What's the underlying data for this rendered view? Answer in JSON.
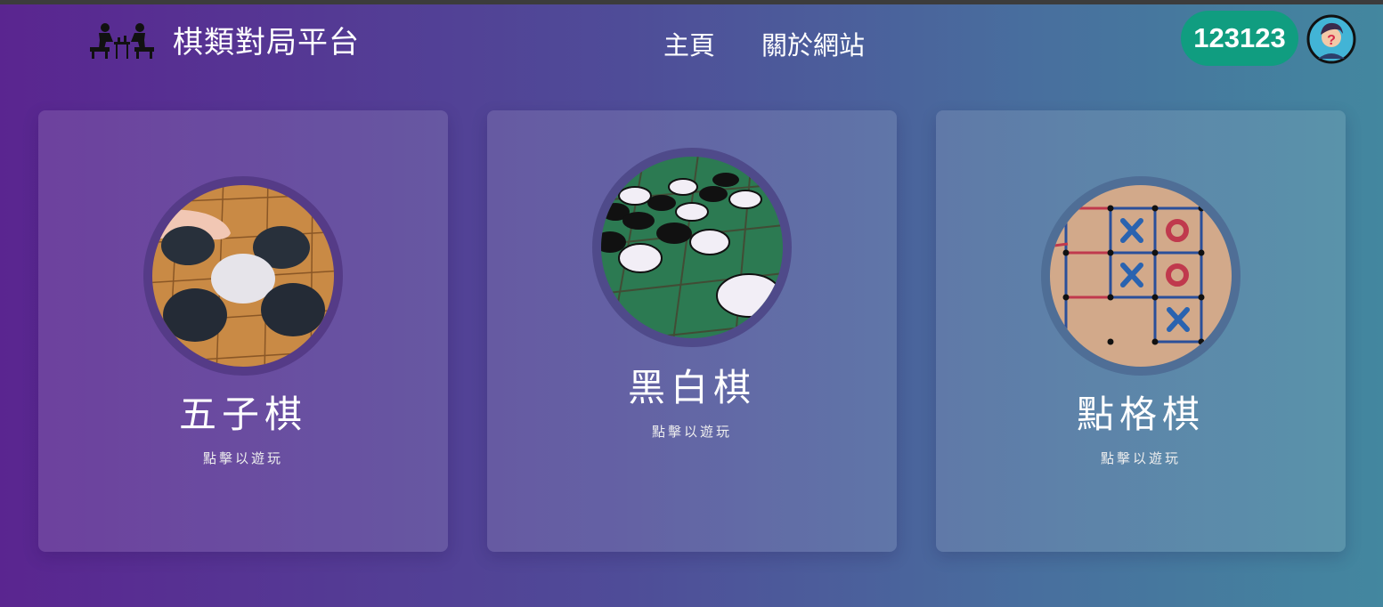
{
  "header": {
    "site_title": "棋類對局平台",
    "logo_icon": "chess-players-icon",
    "nav": [
      {
        "label": "主頁"
      },
      {
        "label": "關於網站"
      }
    ],
    "user_id": "123123",
    "avatar_icon": "unknown-user-avatar-icon"
  },
  "games": [
    {
      "title": "五子棋",
      "subtitle": "點擊以遊玩",
      "image_icon": "gomoku-board-image"
    },
    {
      "title": "黑白棋",
      "subtitle": "點擊以遊玩",
      "image_icon": "othello-board-image"
    },
    {
      "title": "點格棋",
      "subtitle": "點擊以遊玩",
      "image_icon": "dots-and-boxes-image"
    }
  ],
  "colors": {
    "background_left": "#5a2590",
    "background_right": "#43879f",
    "user_badge": "#109d80"
  }
}
